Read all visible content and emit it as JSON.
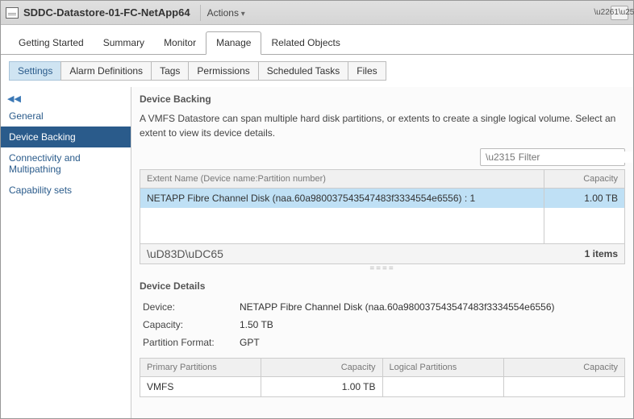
{
  "title": "SDDC-Datastore-01-FC-NetApp64",
  "actions_label": "Actions",
  "top_tabs": {
    "getting_started": "Getting Started",
    "summary": "Summary",
    "monitor": "Monitor",
    "manage": "Manage",
    "related_objects": "Related Objects"
  },
  "sub_tabs": {
    "settings": "Settings",
    "alarm_definitions": "Alarm Definitions",
    "tags": "Tags",
    "permissions": "Permissions",
    "scheduled_tasks": "Scheduled Tasks",
    "files": "Files"
  },
  "sidebar": {
    "collapse_glyph": "◀◀",
    "general": "General",
    "device_backing": "Device Backing",
    "connectivity": "Connectivity and Multipathing",
    "capability_sets": "Capability sets"
  },
  "content": {
    "section_title": "Device Backing",
    "description": "A VMFS Datastore can span multiple hard disk partitions, or extents to create a single logical volume. Select an extent to view its device details.",
    "filter_placeholder": "Filter",
    "extent_columns": {
      "name": "Extent Name (Device name:Partition number)",
      "capacity": "Capacity"
    },
    "extent_rows": [
      {
        "name": "NETAPP Fibre Channel Disk (naa.60a980037543547483f3334554e6556) : 1",
        "capacity": "1.00 TB"
      }
    ],
    "items_count": "1 items",
    "details_title": "Device Details",
    "details": {
      "device_label": "Device:",
      "device_value": "NETAPP Fibre Channel Disk (naa.60a980037543547483f3334554e6556)",
      "capacity_label": "Capacity:",
      "capacity_value": "1.50 TB",
      "pf_label": "Partition Format:",
      "pf_value": "GPT"
    },
    "partition_columns": {
      "primary": "Primary Partitions",
      "primary_capacity": "Capacity",
      "logical": "Logical Partitions",
      "logical_capacity": "Capacity"
    },
    "partition_rows": [
      {
        "primary": "VMFS",
        "primary_capacity": "1.00 TB",
        "logical": "",
        "logical_capacity": ""
      }
    ]
  }
}
